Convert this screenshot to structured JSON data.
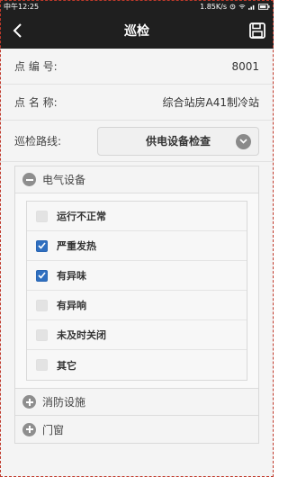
{
  "status_bar": {
    "carrier_time": "中午12:25",
    "speed": "1.85K/s",
    "icons": [
      "alarm-icon",
      "wifi-icon",
      "signal-icon",
      "battery-icon"
    ]
  },
  "app_bar": {
    "title": "巡检",
    "back_icon": "back-arrow-icon",
    "save_icon": "save-icon"
  },
  "info": {
    "point_number_label": "点 编 号:",
    "point_number_value": "8001",
    "point_name_label": "点 名 称:",
    "point_name_value": "综合站房A41制冷站",
    "route_label": "巡检路线:",
    "route_selected": "供电设备检查"
  },
  "sections": {
    "electrical": {
      "label": "电气设备",
      "expanded": true,
      "items": [
        {
          "label": "运行不正常",
          "checked": false
        },
        {
          "label": "严重发热",
          "checked": true
        },
        {
          "label": "有异味",
          "checked": true
        },
        {
          "label": "有异响",
          "checked": false
        },
        {
          "label": "未及时关闭",
          "checked": false
        },
        {
          "label": "其它",
          "checked": false
        }
      ]
    },
    "fire": {
      "label": "消防设施",
      "expanded": false
    },
    "door": {
      "label": "门窗",
      "expanded": false
    }
  },
  "colors": {
    "appbar": "#1f1f1f",
    "checked": "#2f6fc0",
    "frame_border": "#c0392b"
  }
}
